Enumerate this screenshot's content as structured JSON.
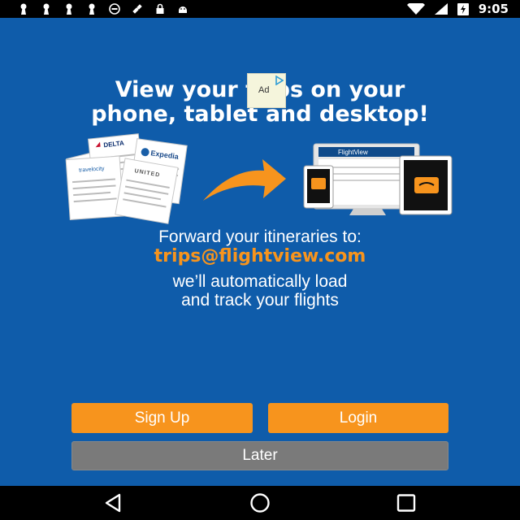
{
  "status_bar": {
    "time": "9:05",
    "icons": [
      "keyhole-icon",
      "keyhole-icon",
      "keyhole-icon",
      "keyhole-icon",
      "circle-info-icon",
      "satellite-icon",
      "lock-icon",
      "android-icon",
      "wifi-icon",
      "signal-icon",
      "battery-charging-icon"
    ]
  },
  "main": {
    "headline_line1": "View your trips on your",
    "headline_line2": "phone, tablet and desktop!",
    "forward_text": "Forward your itineraries to:",
    "email": "trips@flightview.com",
    "auto_line1": "we’ll automatically load",
    "auto_line2": "and track your flights"
  },
  "ad": {
    "label": "Ad"
  },
  "illustration": {
    "brands": [
      "DELTA",
      "Expedia",
      "travelocity",
      "UNITED"
    ],
    "app_name": "FlightView"
  },
  "buttons": {
    "signup": "Sign Up",
    "login": "Login",
    "later": "Later"
  },
  "nav_bar": {
    "icons": [
      "back-icon",
      "home-icon",
      "recents-icon"
    ]
  },
  "colors": {
    "background": "#0f5caa",
    "accent": "#f7941d",
    "later_button": "#7a7a7a"
  }
}
